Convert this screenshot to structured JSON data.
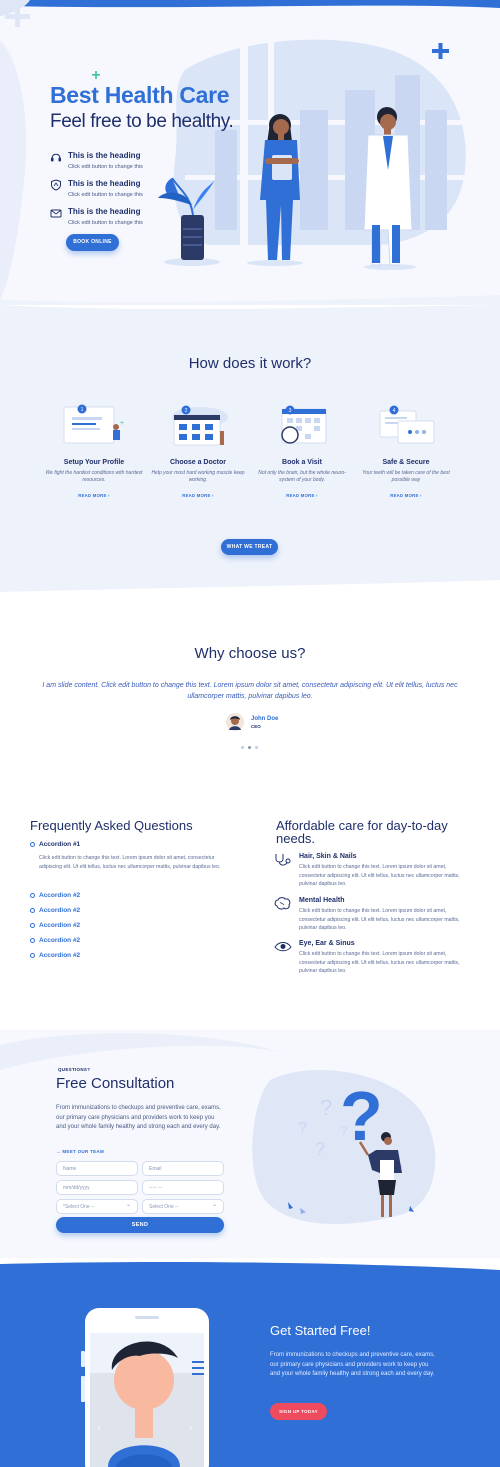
{
  "colors": {
    "primary": "#2f6fd6",
    "dark": "#1f2f6b",
    "accent_red": "#ef4b5f",
    "light_bg": "#eef2fb"
  },
  "hero": {
    "title": "Best Health Care",
    "subtitle": "Feel free to be healthy.",
    "features": [
      {
        "icon": "headset-icon",
        "heading": "This is the heading",
        "text": "Click edit button to change this"
      },
      {
        "icon": "shield-icon",
        "heading": "This is the heading",
        "text": "Click edit button to change this"
      },
      {
        "icon": "mail-icon",
        "heading": "This is the heading",
        "text": "Click edit button to change this"
      }
    ],
    "button": "BOOK ONLINE"
  },
  "how": {
    "title": "How does it work?",
    "steps": [
      {
        "num": "1",
        "title": "Setup Your Profile",
        "text": "We fight the hardest conditions with hardest resources.",
        "link": "READ MORE ›"
      },
      {
        "num": "2",
        "title": "Choose a Doctor",
        "text": "Help your most hard working muscle keep working.",
        "link": "READ MORE ›"
      },
      {
        "num": "3",
        "title": "Book a Visit",
        "text": "Not only the brain, but the whole neuro-system of your body.",
        "link": "READ MORE ›"
      },
      {
        "num": "4",
        "title": "Safe & Secure",
        "text": "Your teeth will be taken care of the best possible way",
        "link": "READ MORE ›"
      }
    ],
    "button": "WHAT WE TREAT"
  },
  "why": {
    "title": "Why choose us?",
    "quote": "I am slide content. Click edit button to change this text. Lorem ipsum dolor sit amet, consectetur adipiscing elit. Ut elit tellus, luctus nec ullamcorper mattis, pulvinar dapibus leo.",
    "author": "John Doe",
    "role": "CEO"
  },
  "faq": {
    "title": "Frequently Asked Questions",
    "open_label": "Accordion #1",
    "open_body": "Click edit button to change this text. Lorem ipsum dolor sit amet, consectetur adipiscing elit. Ut elit tellus, luctus nec ullamcorper mattis, pulvinar dapibus leo.",
    "closed": [
      "Accordion #2",
      "Accordion #2",
      "Accordion #2",
      "Accordion #2",
      "Accordion #2"
    ]
  },
  "care": {
    "title": "Affordable care for day-to-day needs.",
    "items": [
      {
        "icon": "stethoscope-icon",
        "heading": "Hair, Skin & Nails",
        "text": "Click edit button to change this text. Lorem ipsum dolor sit amet, consectetur adipiscing elit. Ut elit tellus, luctus nec ullamcorper mattis, pulvinar dapibus leo."
      },
      {
        "icon": "brain-icon",
        "heading": "Mental Health",
        "text": "Click edit button to change this text. Lorem ipsum dolor sit amet, consectetur adipiscing elit. Ut elit tellus, luctus nec ullamcorper mattis, pulvinar dapibus leo."
      },
      {
        "icon": "eye-icon",
        "heading": "Eye, Ear & Sinus",
        "text": "Click edit button to change this text. Lorem ipsum dolor sit amet, consectetur adipiscing elit. Ut elit tellus, luctus nec ullamcorper mattis, pulvinar dapibus leo."
      }
    ]
  },
  "consult": {
    "kicker": "QUESTIONS?",
    "title": "Free Consultation",
    "text": "From immunizations to checkups and  preventive care, exams, our primary care physicians and providers work to keep you and your whole family healthy and strong each and every day.",
    "team_link": "→ MEET OUR TEAM",
    "form": {
      "name_placeholder": "Name",
      "email_placeholder": "Email",
      "date_placeholder": "mm/dd/yyyy",
      "time_placeholder": "--:-- --",
      "select1": "*Select One --",
      "select2": "Select One --",
      "submit": "SEND"
    }
  },
  "cta": {
    "title": "Get Started Free!",
    "text": "From immunizations to checkups and  preventive care, exams, our primary care physicians and providers work to keep you and your whole family healthy and strong each and every day.",
    "button": "SIGN UP TODAY"
  }
}
